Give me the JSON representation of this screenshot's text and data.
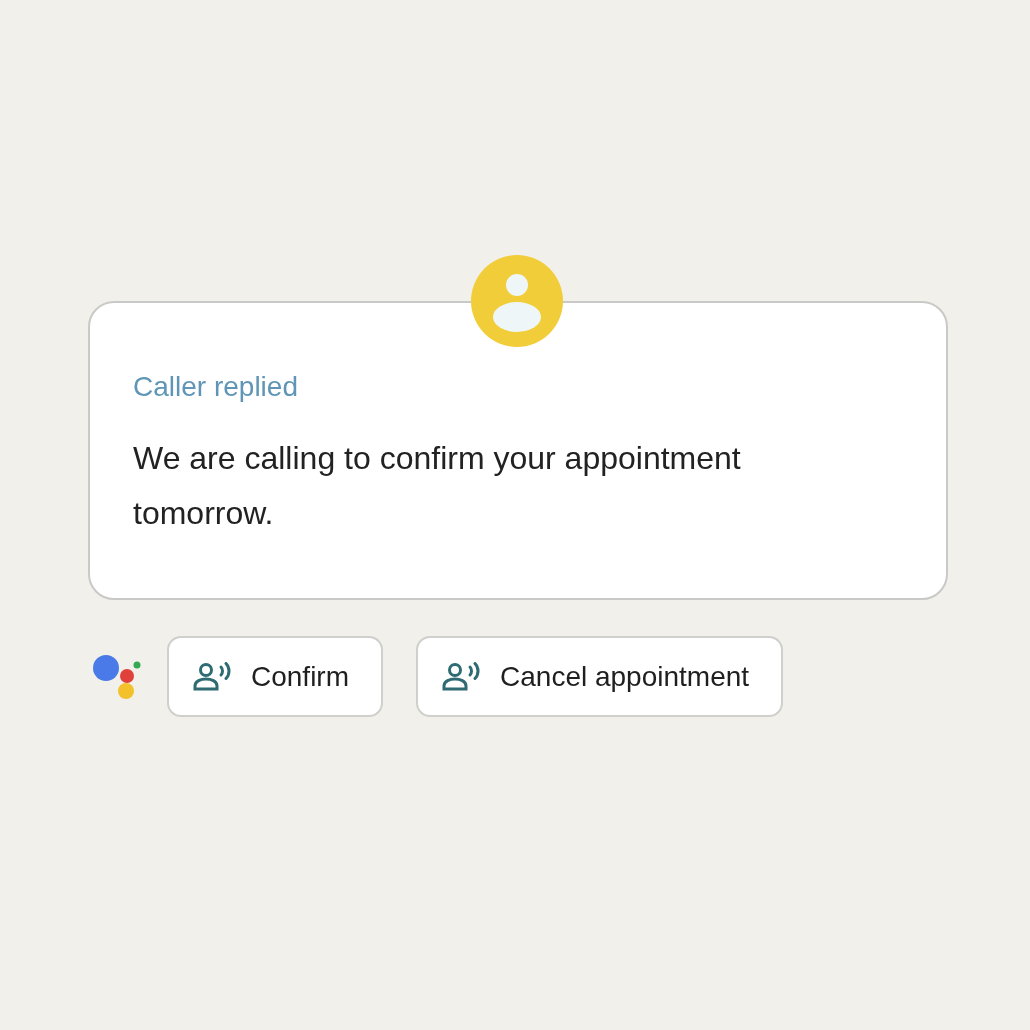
{
  "card": {
    "title": "Caller replied",
    "message": "We are calling to confirm your appointment tomorrow."
  },
  "reply_buttons": [
    {
      "label": "Confirm"
    },
    {
      "label": "Cancel appointment"
    }
  ]
}
